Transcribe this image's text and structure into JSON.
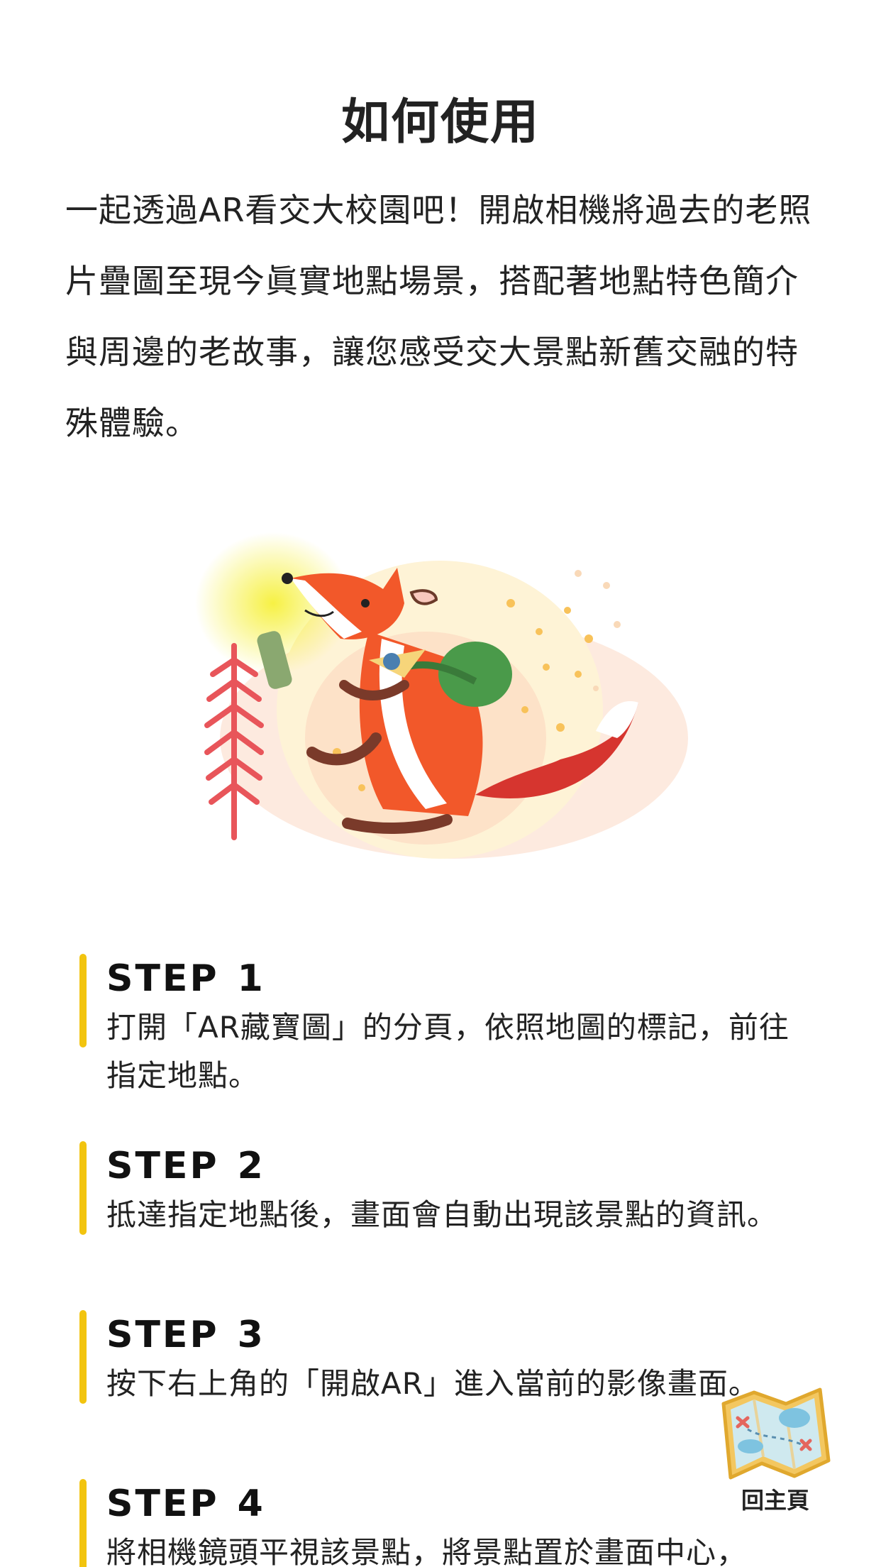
{
  "page": {
    "title": "如何使用",
    "intro": "一起透過AR看交大校園吧！開啟相機將過去的老照片疊圖至現今眞實地點場景，搭配著地點特色簡介與周邊的老故事，讓您感受交大景點新舊交融的特殊體驗。"
  },
  "illustration": {
    "icon": "fox-explorer-with-flashlight-illustration"
  },
  "steps": [
    {
      "label": "STEP",
      "number": "1",
      "desc": "打開「AR藏寶圖」的分頁，依照地圖的標記，前往指定地點。"
    },
    {
      "label": "STEP",
      "number": "2",
      "desc": "抵達指定地點後，畫面會自動出現該景點的資訊。"
    },
    {
      "label": "STEP",
      "number": "3",
      "desc": "按下右上角的「開啟AR」進入當前的影像畫面。"
    },
    {
      "label": "STEP",
      "number": "4",
      "desc": "將相機鏡頭平視該景點，將景點置於畫面中心，"
    }
  ],
  "home_button": {
    "label": "回主頁",
    "icon": "treasure-map-icon"
  },
  "colors": {
    "accent_bar": "#f2c40f",
    "fox_orange": "#f2582a",
    "backpack_green": "#4a9a4a"
  }
}
